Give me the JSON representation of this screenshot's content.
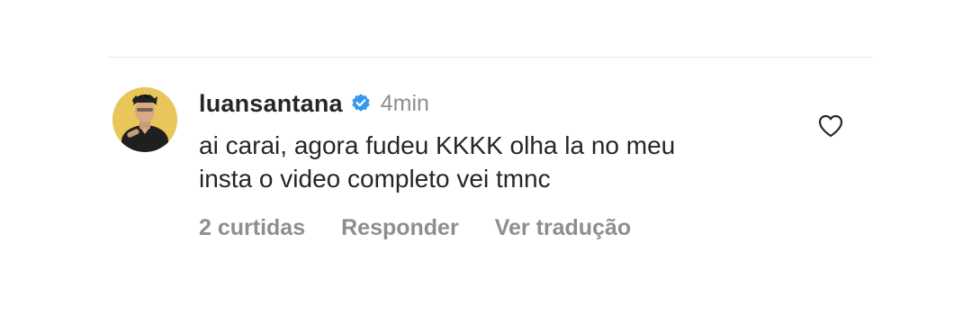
{
  "comment": {
    "username": "luansantana",
    "verified": true,
    "time": "4min",
    "text_line1": "ai carai, agora fudeu KKKK olha la no meu",
    "text_line2": "insta o video completo vei tmnc",
    "likes_label": "2 curtidas",
    "reply_label": "Responder",
    "translate_label": "Ver tradução",
    "avatar_icon": "user-avatar",
    "verified_icon": "verified-badge-icon",
    "like_icon": "heart-outline-icon"
  },
  "colors": {
    "text": "#262626",
    "secondary": "#8e8e8e",
    "verified": "#3897f0",
    "divider": "#e6e6e6"
  }
}
